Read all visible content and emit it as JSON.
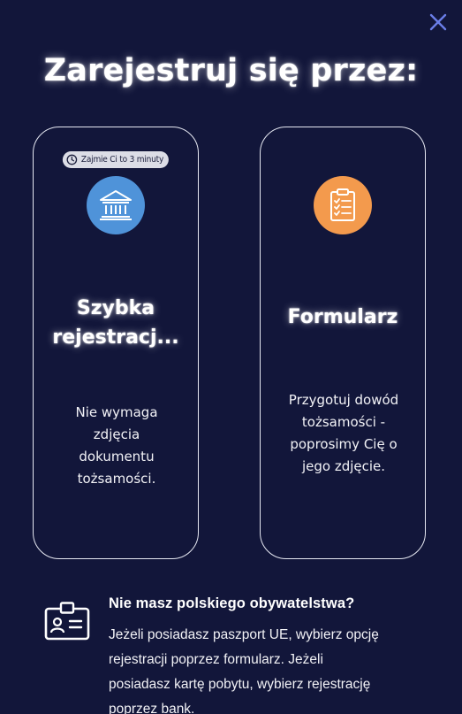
{
  "modal": {
    "title": "Zarejestruj się przez:",
    "close_icon": "close-icon",
    "accent_color": "#6a7ee8",
    "background_color": "#12163a"
  },
  "cards": [
    {
      "badge": "Zajmie Ci to 3 minuty",
      "badge_icon": "clock-icon",
      "icon": "bank-icon",
      "icon_color": "#4f93d9",
      "title_line1": "Szybka",
      "title_line2": "rejestracj...",
      "description": [
        "Nie wymaga",
        "zdjęcia",
        "dokumentu",
        "tożsamości."
      ]
    },
    {
      "icon": "clipboard-checklist-icon",
      "icon_color": "#f39a4d",
      "title": "Formularz",
      "description": [
        "Przygotuj dowód",
        "tożsamości -",
        "poprosimy Cię o",
        "jego zdjęcie."
      ]
    }
  ],
  "info": {
    "icon": "id-badge-icon",
    "title": "Nie masz polskiego obywatelstwa?",
    "text": [
      "Jeżeli posiadasz paszport UE, wybierz opcję",
      "rejestracji poprzez formularz. Jeżeli",
      "posiadasz kartę pobytu, wybierz rejestrację",
      "poprzez bank."
    ]
  }
}
